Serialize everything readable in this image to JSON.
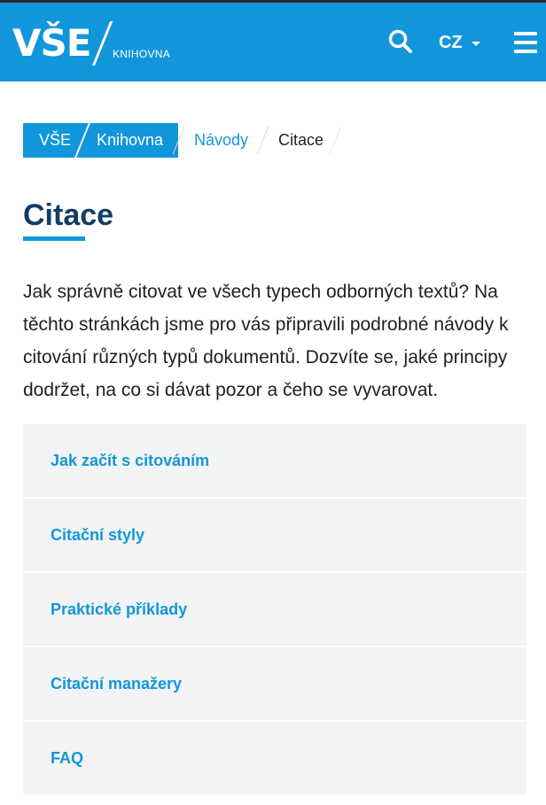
{
  "header": {
    "logo_text": "VŠE",
    "logo_subtitle": "KNIHOVNA",
    "language": "CZ",
    "brand_color": "#1296db"
  },
  "breadcrumb": {
    "items": [
      "VŠE",
      "Knihovna",
      "Návody",
      "Citace"
    ]
  },
  "page": {
    "title": "Citace",
    "intro": "Jak správně citovat ve všech typech odborných textů? Na těchto stránkách jsme pro vás připravili podrobné návody k citování různých typů dokumentů. Dozvíte se, jaké principy dodržet, na co si dávat pozor a čeho se vyvarovat."
  },
  "nav_list": {
    "items": [
      {
        "label": "Jak začít s citováním"
      },
      {
        "label": "Citační styly"
      },
      {
        "label": "Praktické příklady"
      },
      {
        "label": "Citační manažery"
      },
      {
        "label": "FAQ"
      }
    ]
  }
}
